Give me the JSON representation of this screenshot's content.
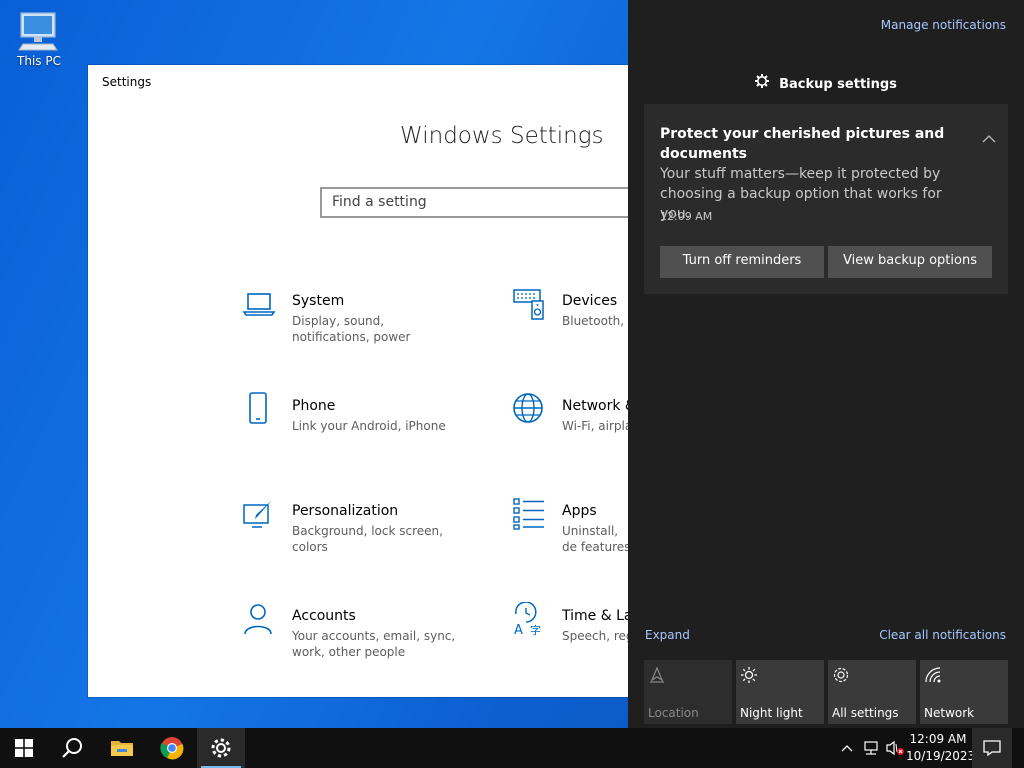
{
  "desktop": {
    "this_pc_label": "This PC"
  },
  "settings": {
    "window_title": "Settings",
    "heading": "Windows Settings",
    "search_placeholder": "Find a setting",
    "items": [
      {
        "name": "System",
        "desc": "Display, sound, notifications, power",
        "icon": "laptop-icon"
      },
      {
        "name": "Devices",
        "desc": "Bluetooth, p",
        "icon": "keyboard-speaker-icon"
      },
      {
        "name": "Phone",
        "desc": "Link your Android, iPhone",
        "icon": "phone-icon"
      },
      {
        "name": "Network &",
        "desc": "Wi-Fi, airplan",
        "icon": "globe-icon"
      },
      {
        "name": "Personalization",
        "desc": "Background, lock screen, colors",
        "icon": "paintbrush-icon"
      },
      {
        "name": "Apps",
        "desc": "Uninstall, de features",
        "icon": "apps-list-icon"
      },
      {
        "name": "Accounts",
        "desc": "Your accounts, email, sync, work, other people",
        "icon": "person-icon"
      },
      {
        "name": "Time & Lar",
        "desc": "Speech, reg",
        "icon": "time-language-icon"
      }
    ]
  },
  "action_center": {
    "manage_notifications": "Manage notifications",
    "group_title": "Backup settings",
    "toast": {
      "title": "Protect your cherished pictures and documents",
      "body": "Your stuff matters—keep it protected by choosing a backup option that works for you.",
      "time": "12:09 AM",
      "button_1": "Turn off reminders",
      "button_2": "View backup options"
    },
    "expand": "Expand",
    "clear_all": "Clear all notifications",
    "quick_actions": [
      {
        "label": "Location",
        "icon": "location-icon",
        "enabled": false
      },
      {
        "label": "Night light",
        "icon": "night-light-icon",
        "enabled": true
      },
      {
        "label": "All settings",
        "icon": "gear-icon",
        "enabled": true
      },
      {
        "label": "Network",
        "icon": "network-icon",
        "enabled": true
      }
    ]
  },
  "taskbar": {
    "time": "12:09 AM",
    "date": "10/19/2023",
    "accent": "#76b9ed"
  }
}
